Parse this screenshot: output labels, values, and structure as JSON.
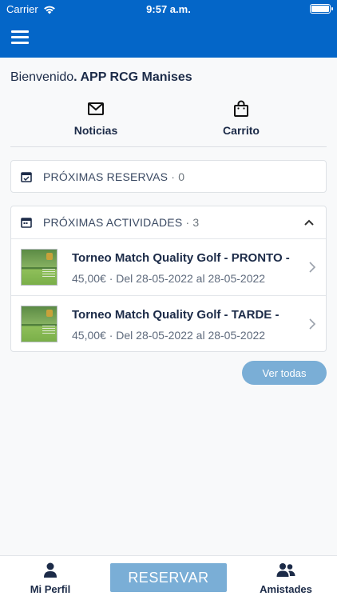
{
  "status_bar": {
    "carrier": "Carrier",
    "time": "9:57 a.m."
  },
  "welcome": {
    "prefix": "Bienvenido",
    "app_name": ". APP RCG Manises"
  },
  "quick_actions": [
    {
      "label": "Noticias",
      "icon": "mail-icon"
    },
    {
      "label": "Carrito",
      "icon": "shopping-bag-icon"
    }
  ],
  "reservas": {
    "title": "PRÓXIMAS RESERVAS",
    "count": " · 0",
    "icon": "calendar-check-icon"
  },
  "actividades": {
    "title": "PRÓXIMAS ACTIVIDADES",
    "count": " · 3",
    "icon": "calendar-icon",
    "items": [
      {
        "title": "Torneo Match Quality Golf - PRONTO -",
        "detail": "45,00€ · Del 28-05-2022 al 28-05-2022"
      },
      {
        "title": "Torneo Match Quality Golf - TARDE -",
        "detail": "45,00€ · Del 28-05-2022 al 28-05-2022"
      }
    ],
    "view_all": "Ver todas"
  },
  "tabbar": {
    "profile": "Mi Perfil",
    "reserve": "RESERVAR",
    "friends": "Amistades"
  },
  "colors": {
    "header": "#0466c8",
    "accent_button": "#7aaed6",
    "text": "#1c2b48"
  }
}
